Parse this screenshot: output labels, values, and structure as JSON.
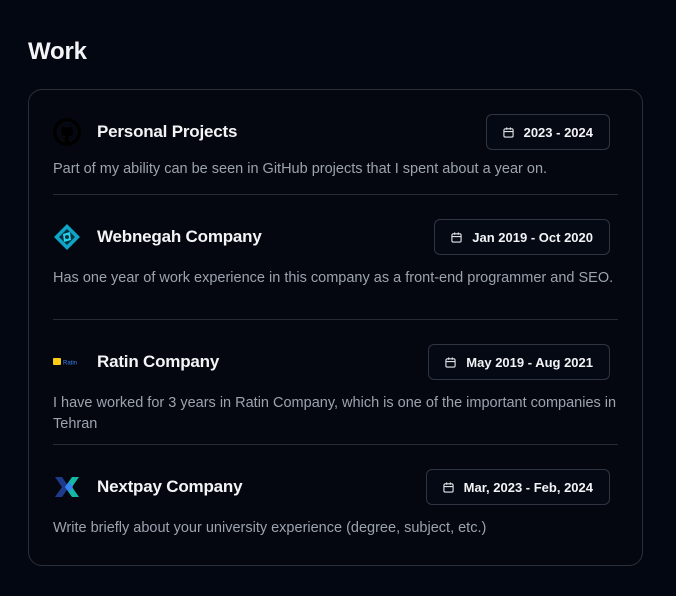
{
  "section": {
    "title": "Work"
  },
  "items": [
    {
      "company": "Personal Projects",
      "date": "2023 - 2024",
      "description": "Part of my ability can be seen in GitHub projects that I spent about a year on.",
      "logo_icon": "github-icon"
    },
    {
      "company": "Webnegah Company",
      "date": "Jan 2019 - Oct 2020",
      "description": "Has one year of work experience in this company as a front-end programmer and SEO.",
      "logo_icon": "webnegah-logo-icon"
    },
    {
      "company": "Ratin Company",
      "date": "May 2019 - Aug 2021",
      "description": "I have worked for 3 years in Ratin Company, which is one of the important companies in Tehran",
      "logo_icon": "ratin-logo-icon",
      "logo_text": "Ratin"
    },
    {
      "company": "Nextpay Company",
      "date": "Mar, 2023 - Feb, 2024",
      "description": "Write briefly about your university experience (degree, subject, etc.)",
      "logo_icon": "nextpay-logo-icon"
    }
  ],
  "icons": {
    "date": "calendar-icon"
  },
  "colors": {
    "background": "#030712",
    "border": "#2a2f3a",
    "text": "#f3f4f6",
    "muted": "#9ca3af"
  }
}
